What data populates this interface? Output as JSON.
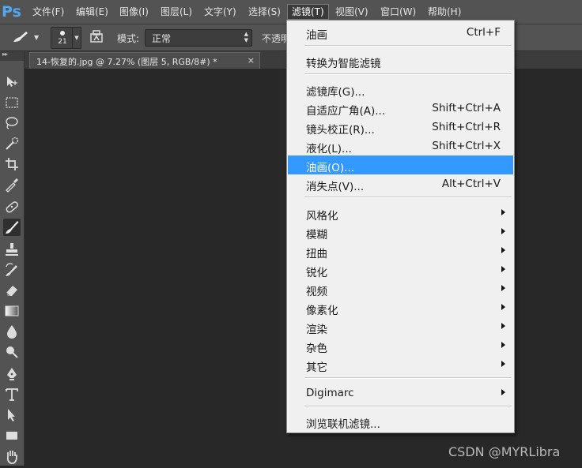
{
  "app": {
    "logo": "Ps"
  },
  "menubar": {
    "items": [
      {
        "label": "文件(F)"
      },
      {
        "label": "编辑(E)"
      },
      {
        "label": "图像(I)"
      },
      {
        "label": "图层(L)"
      },
      {
        "label": "文字(Y)"
      },
      {
        "label": "选择(S)"
      },
      {
        "label": "滤镜(T)"
      },
      {
        "label": "视图(V)"
      },
      {
        "label": "窗口(W)"
      },
      {
        "label": "帮助(H)"
      }
    ],
    "active_index": 6
  },
  "options": {
    "brush_size": "21",
    "mode_label": "模式:",
    "mode_value": "正常",
    "opacity_label": "不透明"
  },
  "document": {
    "tab_title": "14-恢复的.jpg @ 7.27% (图层 5, RGB/8#) *",
    "close": "×"
  },
  "toolbar": {
    "collapse": "▸▸"
  },
  "filter_menu": {
    "items": [
      {
        "label": "油画",
        "shortcut": "Ctrl+F"
      },
      {
        "label": "转换为智能滤镜"
      },
      {
        "label": "滤镜库(G)..."
      },
      {
        "label": "自适应广角(A)...",
        "shortcut": "Shift+Ctrl+A"
      },
      {
        "label": "镜头校正(R)...",
        "shortcut": "Shift+Ctrl+R"
      },
      {
        "label": "液化(L)...",
        "shortcut": "Shift+Ctrl+X"
      },
      {
        "label": "油画(O)...",
        "highlighted": true
      },
      {
        "label": "消失点(V)...",
        "shortcut": "Alt+Ctrl+V"
      },
      {
        "label": "风格化",
        "submenu": true
      },
      {
        "label": "模糊",
        "submenu": true
      },
      {
        "label": "扭曲",
        "submenu": true
      },
      {
        "label": "锐化",
        "submenu": true
      },
      {
        "label": "视频",
        "submenu": true
      },
      {
        "label": "像素化",
        "submenu": true
      },
      {
        "label": "渲染",
        "submenu": true
      },
      {
        "label": "杂色",
        "submenu": true
      },
      {
        "label": "其它",
        "submenu": true
      },
      {
        "label": "Digimarc",
        "submenu": true
      },
      {
        "label": "浏览联机滤镜..."
      }
    ]
  },
  "watermark": "CSDN @MYRLibra",
  "colors": {
    "highlight": "#3399ff",
    "ps_blue": "#4fa8f0",
    "chrome": "#535353",
    "workspace": "#282828"
  }
}
